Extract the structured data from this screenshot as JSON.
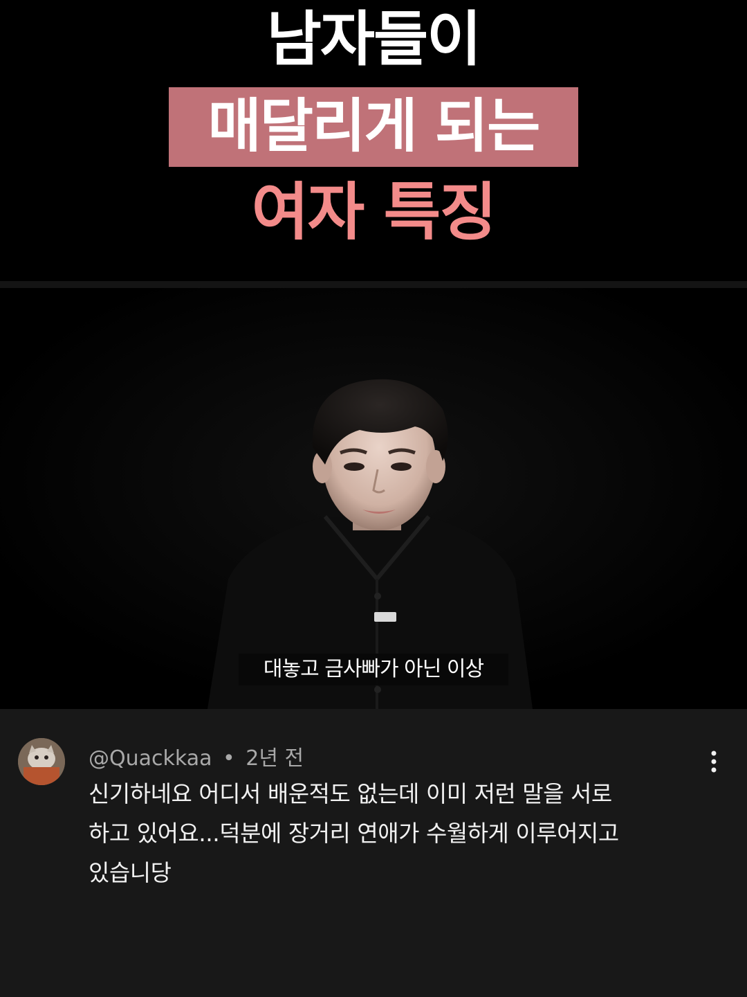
{
  "title": {
    "line1": "남자들이",
    "line2": "매달리게 되는",
    "line3": "여자 특징",
    "colors": {
      "line1": "#ffffff",
      "line2_text": "#ffffff",
      "line2_highlight": "#c07278",
      "line3": "#f38b8a"
    }
  },
  "video": {
    "subtitle": "대놓고 금사빠가 아닌 이상"
  },
  "comment": {
    "author": "@Quackkaa",
    "separator": "•",
    "time": "2년 전",
    "lines": [
      "신기하네요 어디서 배운적도 없는데 이미 저런 말을 서로",
      "하고 있어요...덕분에 장거리 연애가 수월하게 이루어지고",
      "있습니당"
    ],
    "avatar_icon": "cat-avatar-icon",
    "more_icon": "more-vertical-icon"
  }
}
